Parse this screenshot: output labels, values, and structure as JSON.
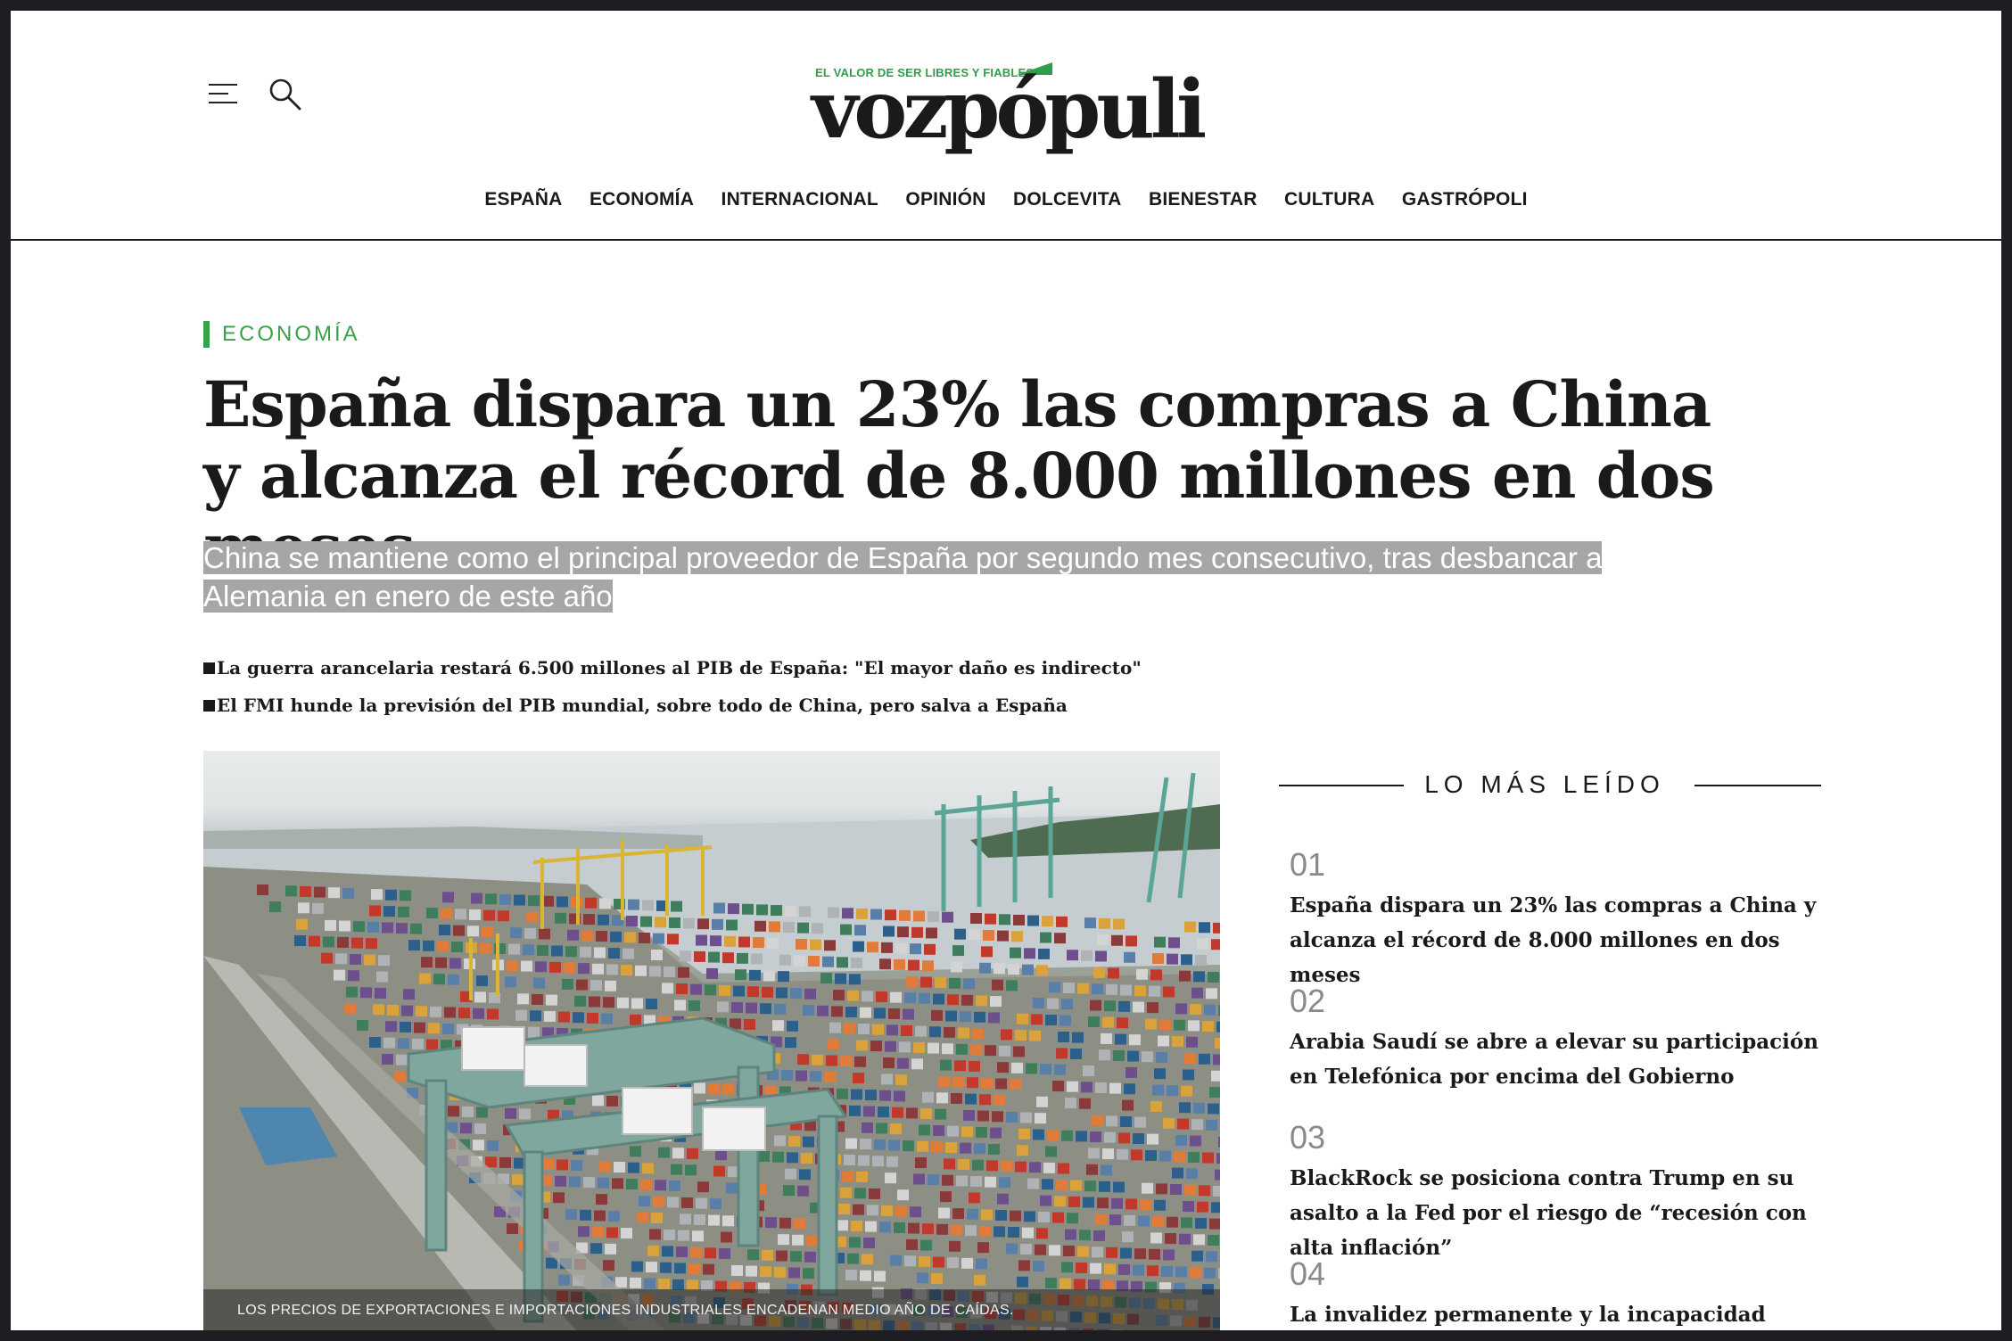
{
  "header": {
    "logo_tagline": "EL VALOR DE SER LIBRES Y FIABLES",
    "logo_text": "vozpópuli",
    "nav": [
      "ESPAÑA",
      "ECONOMÍA",
      "INTERNACIONAL",
      "OPINIÓN",
      "DOLCEVITA",
      "BIENESTAR",
      "CULTURA",
      "GASTRÓPOLI"
    ]
  },
  "article": {
    "section": "ECONOMÍA",
    "headline": "España dispara un 23% las compras a China y alcanza el récord de 8.000 millones en dos meses",
    "subtitle": "China se mantiene como el principal proveedor de España por segundo mes consecutivo, tras desbancar a Alemania en enero de este año",
    "related": [
      "La guerra arancelaria restará 6.500 millones al PIB de España: \"El mayor daño es indirecto\"",
      "El FMI hunde la previsión del PIB mundial, sobre todo de China, pero salva a España"
    ],
    "image_caption": "LOS PRECIOS DE EXPORTACIONES E IMPORTACIONES INDUSTRIALES ENCADENAN MEDIO AÑO DE CAÍDAS."
  },
  "sidebar": {
    "title": "LO MÁS LEÍDO",
    "items": [
      {
        "num": "01",
        "title": "España dispara un 23% las compras a China y alcanza el récord de 8.000 millones en dos meses"
      },
      {
        "num": "02",
        "title": "Arabia Saudí se abre a elevar su participación en Telefónica por encima del Gobierno"
      },
      {
        "num": "03",
        "title": "BlackRock se posiciona contra Trump en su asalto a la Fed por el riesgo de “recesión con alta inflación”"
      },
      {
        "num": "04",
        "title": "La invalidez permanente y la incapacidad total ya no"
      }
    ]
  },
  "colors": {
    "accent_green": "#3aa14b",
    "text": "#1a1a1a",
    "subtitle_highlight": "#a6a6a6"
  },
  "icons": [
    "menu-icon",
    "search-icon"
  ]
}
